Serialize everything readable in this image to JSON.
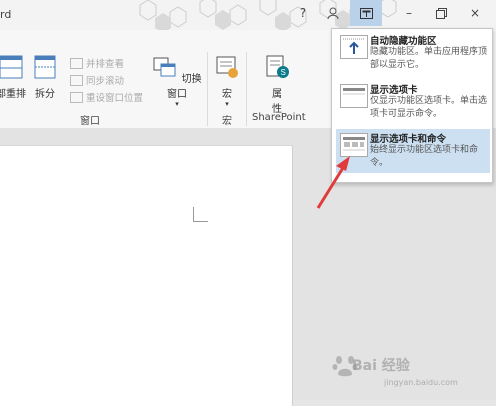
{
  "window": {
    "title_fragment": "rd",
    "controls": [
      "?",
      "ribbon",
      "–",
      "restore",
      "×"
    ]
  },
  "ribbon": {
    "buttons": {
      "arrange_all": "部重排",
      "split": "拆分",
      "side_by_side": "并排查看",
      "sync_scroll": "同步滚动",
      "reset_position": "重设窗口位置",
      "switch_windows": "切换窗口",
      "macros": "宏",
      "properties_line1": "属",
      "properties_line2": "性"
    },
    "groups": {
      "window": "窗口",
      "macros": "宏",
      "sharepoint": "SharePoint"
    }
  },
  "ribbon_options": {
    "items": [
      {
        "title": "自动隐藏功能区",
        "desc": "隐藏功能区。单击应用程序顶部以显示它。"
      },
      {
        "title": "显示选项卡",
        "desc": "仅显示功能区选项卡。单击选项卡可显示命令。"
      },
      {
        "title": "显示选项卡和命令",
        "desc": "始终显示功能区选项卡和命令。"
      }
    ],
    "selected_index": 2
  },
  "annotation": {
    "arrow_color": "#e03c3c"
  },
  "watermark": {
    "text": "Bai 经验",
    "url": "jingyan.baidu.com"
  },
  "colors": {
    "accent": "#2b579a",
    "selected": "#cde0f2",
    "arrow": "#e03c3c"
  }
}
